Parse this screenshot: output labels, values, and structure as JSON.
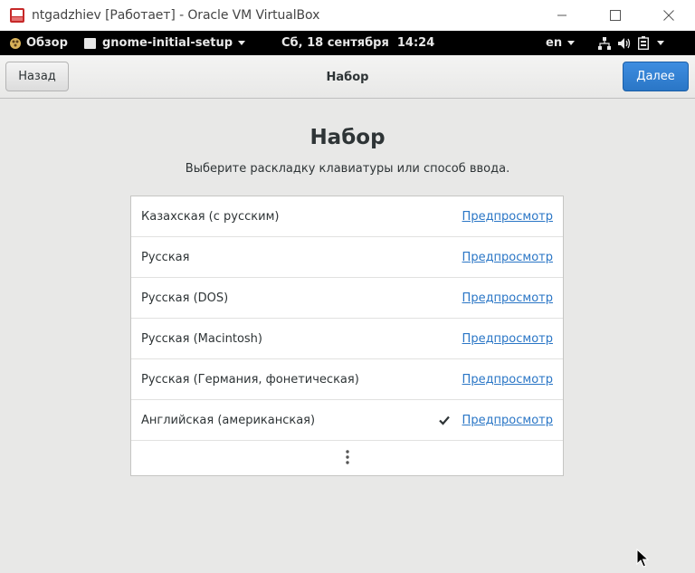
{
  "window": {
    "title": "ntgadzhiev [Работает] - Oracle VM VirtualBox",
    "controls": [
      "minimize-icon",
      "maximize-icon",
      "close-icon"
    ]
  },
  "topbar": {
    "activities": "Обзор",
    "app": "gnome-initial-setup",
    "clock": "Сб, 18 сентября  14:24",
    "lang": "en",
    "icons": [
      "network-icon",
      "volume-icon",
      "battery-icon"
    ]
  },
  "header": {
    "back": "Назад",
    "title": "Набор",
    "next": "Далее"
  },
  "main": {
    "heading": "Набор",
    "subtitle": "Выберите раскладку клавиатуры или способ ввода.",
    "layouts": [
      {
        "label": "Казахская (с русским)",
        "preview": "Предпросмотр",
        "selected": false
      },
      {
        "label": "Русская",
        "preview": "Предпросмотр",
        "selected": false
      },
      {
        "label": "Русская (DOS)",
        "preview": "Предпросмотр",
        "selected": false
      },
      {
        "label": "Русская (Macintosh)",
        "preview": "Предпросмотр",
        "selected": false
      },
      {
        "label": "Русская (Германия, фонетическая)",
        "preview": "Предпросмотр",
        "selected": false
      },
      {
        "label": "Английская (американская)",
        "preview": "Предпросмотр",
        "selected": true
      }
    ],
    "more_icon": "view-more-icon"
  },
  "colors": {
    "accent": "#2a76c6",
    "background": "#e8e8e7",
    "topbar": "#000000"
  }
}
